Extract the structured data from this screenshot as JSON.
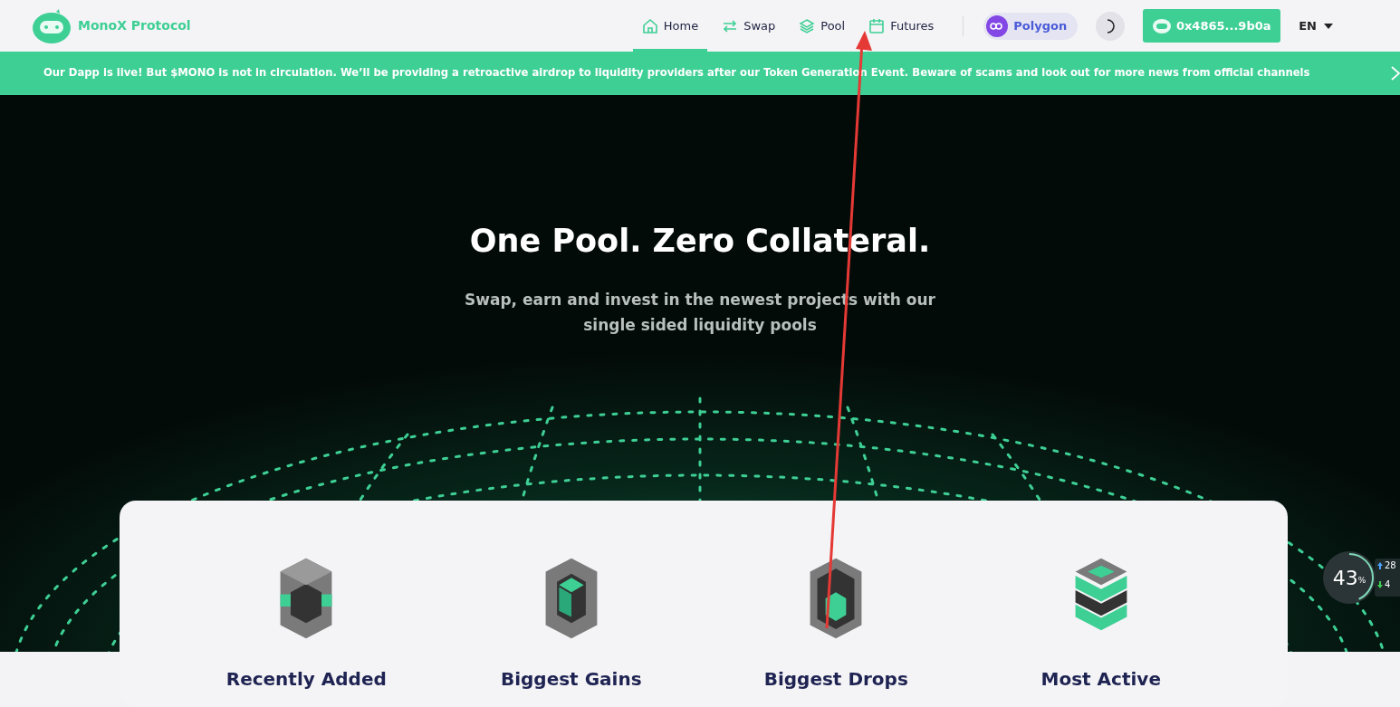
{
  "brand": {
    "name": "MonoX Protocol"
  },
  "nav": [
    {
      "label": "Home",
      "selected": true
    },
    {
      "label": "Swap",
      "selected": false
    },
    {
      "label": "Pool",
      "selected": false
    },
    {
      "label": "Futures",
      "selected": false
    }
  ],
  "network": {
    "label": "Polygon"
  },
  "wallet": {
    "label": "0x4865...9b0a"
  },
  "language": {
    "label": "EN"
  },
  "banner": {
    "text": "Our Dapp is live! But $MONO is not in circulation. We’ll be providing a retroactive airdrop to liquidity providers after our Token Generation Event. Beware of scams and look out for more news from official channels"
  },
  "hero": {
    "title": "One Pool. Zero Collateral.",
    "subtitle": "Swap, earn and invest in the newest projects with our single sided liquidity pools"
  },
  "categories": [
    {
      "title": "Recently Added"
    },
    {
      "title": "Biggest Gains"
    },
    {
      "title": "Biggest Drops"
    },
    {
      "title": "Most Active"
    }
  ],
  "speed_widget": {
    "percent": "43",
    "unit": "%",
    "up": "28",
    "down": "4",
    "level": 0.43
  }
}
